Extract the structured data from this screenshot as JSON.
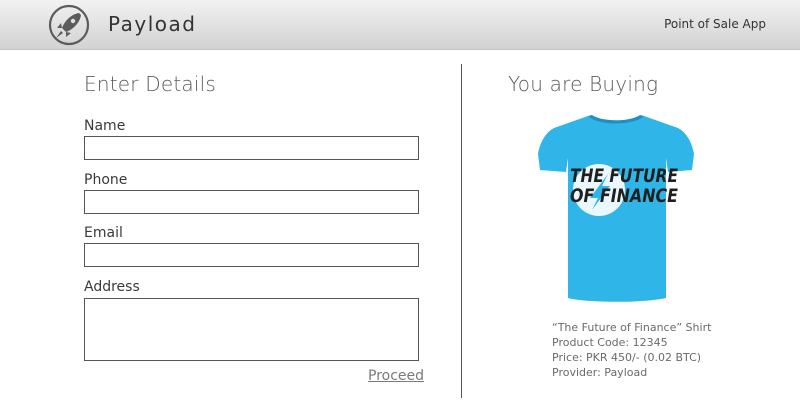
{
  "header": {
    "brand": "Payload",
    "app_label": "Point of Sale App",
    "logo_icon": "rocket-icon"
  },
  "form": {
    "title": "Enter Details",
    "name_label": "Name",
    "name_value": "",
    "phone_label": "Phone",
    "phone_value": "",
    "email_label": "Email",
    "email_value": "",
    "address_label": "Address",
    "address_value": "",
    "proceed_label": "Proceed"
  },
  "purchase": {
    "title": "You are Buying",
    "shirt_color": "#2fb5e8",
    "shirt_text_line1": "THE FUTURE",
    "shirt_text_line2": "OF FINANCE",
    "product_name": "“The Future of Finance” Shirt",
    "product_code": "Product Code: 12345",
    "price": "Price: PKR 450/- (0.02 BTC)",
    "provider": "Provider: Payload"
  }
}
